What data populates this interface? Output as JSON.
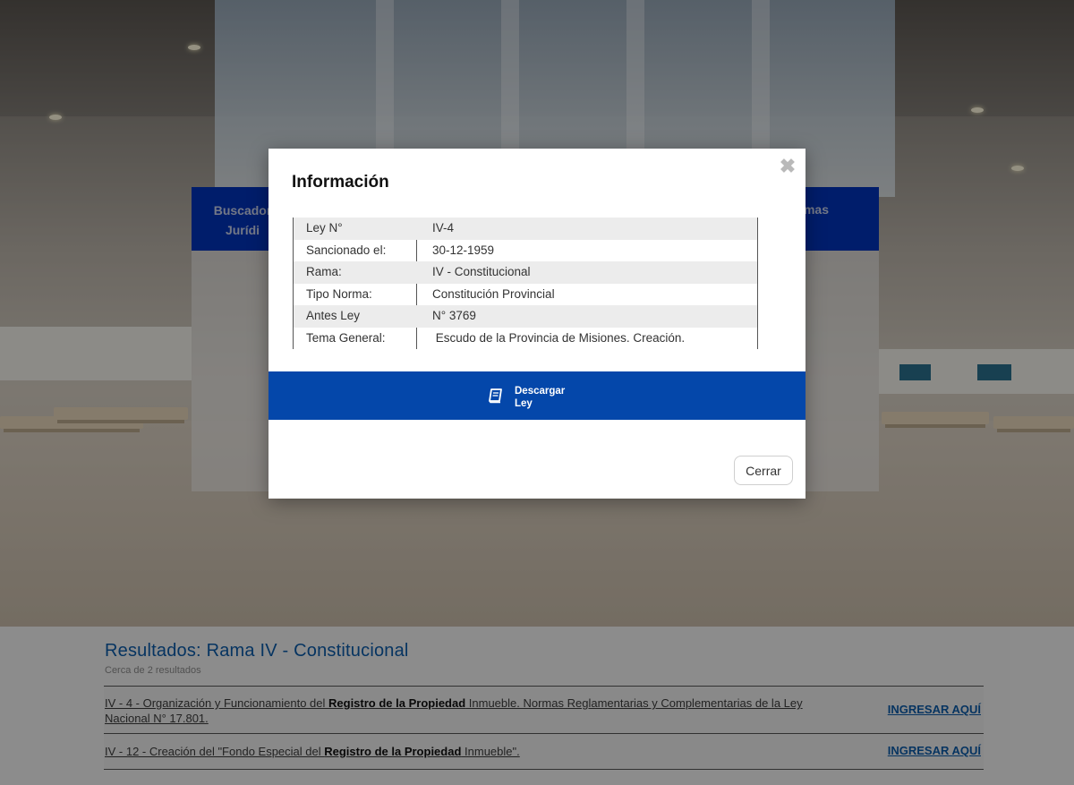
{
  "nav": {
    "left_label": "Buscador Jurídi",
    "right_label": "mas"
  },
  "modal": {
    "title": "Información",
    "close_icon": "close-icon",
    "rows": [
      {
        "label": "Ley N°",
        "value": "IV-4"
      },
      {
        "label": "Sancionado el:",
        "value": "30-12-1959"
      },
      {
        "label": "Rama:",
        "value": "IV - Constitucional"
      },
      {
        "label": "Tipo Norma:",
        "value": "Constitución Provincial"
      },
      {
        "label": "Antes Ley",
        "value": "N° 3769"
      },
      {
        "label": "Tema General:",
        "value": " Escudo de la Provincia de Misiones. Creación."
      }
    ],
    "download": {
      "line1": "Descargar",
      "line2": "Ley",
      "icon": "book-icon"
    },
    "close_label": "Cerrar"
  },
  "results": {
    "title": "Resultados: Rama IV - Constitucional",
    "count": "Cerca de 2 resultados",
    "items": [
      {
        "pre": "IV - 4 - Organización y Funcionamiento del ",
        "bold": "Registro de la Propiedad",
        "post": " Inmueble. Normas Reglamentarias y Complementarias de la Ley Nacional N° 17.801.",
        "action": "INGRESAR AQUÍ"
      },
      {
        "pre": "IV - 12 - Creación del \"Fondo Especial del ",
        "bold": "Registro de la Propiedad",
        "post": " Inmueble\".",
        "action": "INGRESAR AQUÍ"
      }
    ]
  },
  "colors": {
    "primary_blue": "#0447aa",
    "nav_blue": "#0033b8",
    "title_blue": "#0c5aa7"
  }
}
